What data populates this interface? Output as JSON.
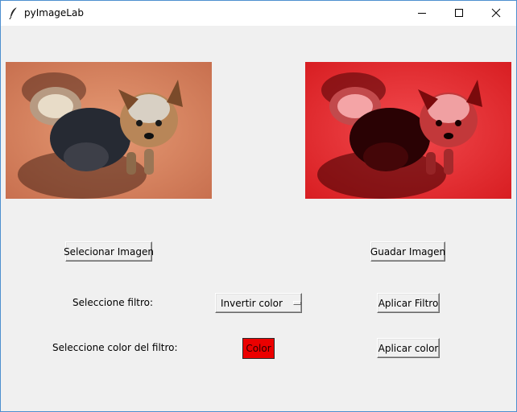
{
  "window": {
    "title": "pyImageLab",
    "icon": "feather-icon",
    "controls": {
      "minimize": "minimize-icon",
      "maximize": "maximize-icon",
      "close": "close-icon"
    }
  },
  "images": {
    "original": {
      "subject": "yorkshire terrier photo",
      "tint": "#e08a64"
    },
    "filtered": {
      "subject": "yorkshire terrier photo red filter",
      "tint": "#ec2f33"
    }
  },
  "buttons": {
    "select_image": "Selecionar Imagen",
    "save_image": "Guadar Imagen",
    "apply_filter": "Aplicar Filtro",
    "apply_color": "Aplicar color",
    "color": "Color"
  },
  "filter": {
    "label": "Seleccione filtro:",
    "selected": "Invertir color"
  },
  "color": {
    "label": "Seleccione color del filtro:",
    "swatch": "#ec0000"
  }
}
